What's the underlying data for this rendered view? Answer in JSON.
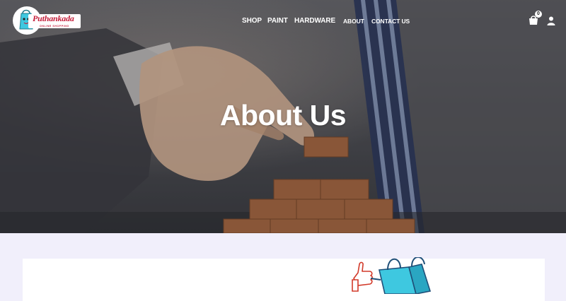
{
  "brand": {
    "name": "Puthankada",
    "tagline": "ONLINE SHOPPING"
  },
  "nav": {
    "items": [
      {
        "label": "SHOP"
      },
      {
        "label": "PAINT"
      },
      {
        "label": "HARDWARE"
      },
      {
        "label": "ABOUT"
      },
      {
        "label": "CONTACT US"
      }
    ]
  },
  "cart": {
    "count": "0",
    "icon": "shopping-bag-icon"
  },
  "user": {
    "icon": "user-icon"
  },
  "hero": {
    "title": "About Us"
  },
  "colors": {
    "brand_red": "#c41e3a",
    "page_bg": "#f1effb",
    "mascot_blue": "#3ec8e0"
  }
}
